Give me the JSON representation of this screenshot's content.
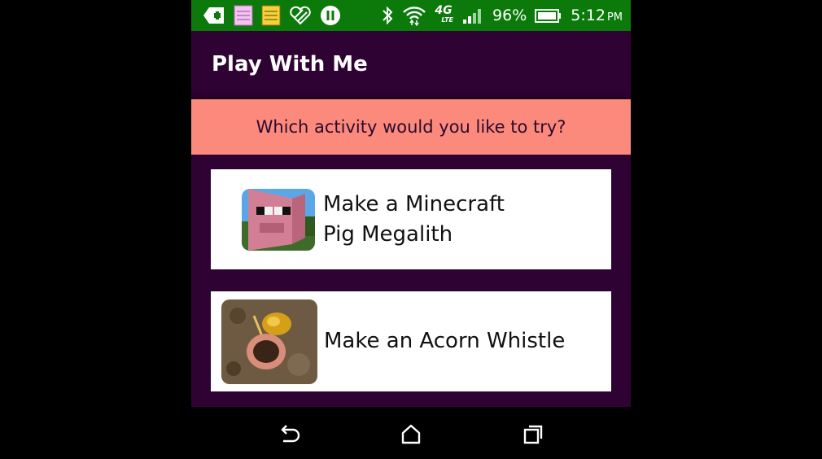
{
  "status_bar": {
    "battery_percent": "96%",
    "time": "5:12",
    "ampm": "PM",
    "network": "4G",
    "network_sub": "LTE",
    "icons": [
      "medical-plus-icon",
      "notepad-pink-icon",
      "notepad-yellow-icon",
      "heart-pattern-icon",
      "pause-circle-icon",
      "bluetooth-icon",
      "wifi-icon",
      "4g-lte-icon",
      "signal-icon",
      "battery-icon"
    ]
  },
  "app_bar": {
    "title": "Play With Me"
  },
  "prompt": {
    "text": "Which activity would you like to try?"
  },
  "activities": [
    {
      "label": "Make a Minecraft Pig Megalith",
      "image": "minecraft-pig-megalith-thumbnail"
    },
    {
      "label": "Make an Acorn Whistle",
      "image": "acorn-whistle-thumbnail"
    }
  ],
  "nav_bar": {
    "buttons": [
      "back-icon",
      "home-icon",
      "recent-apps-icon"
    ]
  },
  "colors": {
    "status_bar": "#0b7a0b",
    "app_background": "#2e0232",
    "prompt_banner": "#fc8a7c",
    "card": "#ffffff",
    "outside": "#000000"
  }
}
